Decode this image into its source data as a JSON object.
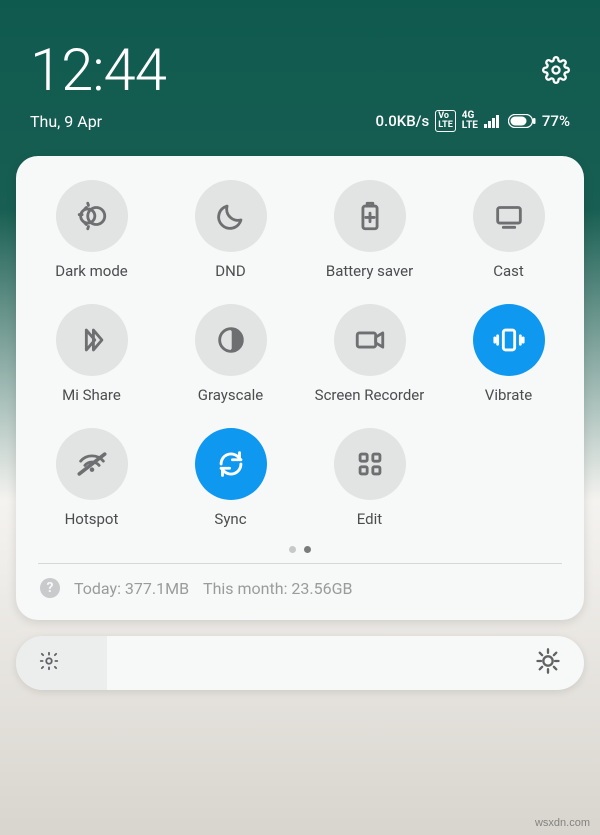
{
  "status": {
    "time": "12:44",
    "date": "Thu, 9 Apr",
    "dataRate": "0.0KB/s",
    "volte": "VoLTE",
    "network": "4G",
    "battery": "77%"
  },
  "tiles": [
    {
      "id": "dark-mode",
      "label": "Dark mode",
      "icon": "dark-mode-icon",
      "active": false
    },
    {
      "id": "dnd",
      "label": "DND",
      "icon": "dnd-icon",
      "active": false
    },
    {
      "id": "battery-saver",
      "label": "Battery saver",
      "icon": "battery-saver-icon",
      "active": false
    },
    {
      "id": "cast",
      "label": "Cast",
      "icon": "cast-icon",
      "active": false
    },
    {
      "id": "mi-share",
      "label": "Mi Share",
      "icon": "mi-share-icon",
      "active": false
    },
    {
      "id": "grayscale",
      "label": "Grayscale",
      "icon": "grayscale-icon",
      "active": false
    },
    {
      "id": "screen-recorder",
      "label": "Screen Recorder",
      "icon": "screen-recorder-icon",
      "active": false
    },
    {
      "id": "vibrate",
      "label": "Vibrate",
      "icon": "vibrate-icon",
      "active": true
    },
    {
      "id": "hotspot",
      "label": "Hotspot",
      "icon": "hotspot-icon",
      "active": false
    },
    {
      "id": "sync",
      "label": "Sync",
      "icon": "sync-icon",
      "active": true
    },
    {
      "id": "edit",
      "label": "Edit",
      "icon": "edit-icon",
      "active": false
    }
  ],
  "pager": {
    "count": 2,
    "current": 1
  },
  "usage": {
    "today_label": "Today:",
    "today_value": "377.1MB",
    "month_label": "This month:",
    "month_value": "23.56GB"
  },
  "watermark": "wsxdn.com"
}
